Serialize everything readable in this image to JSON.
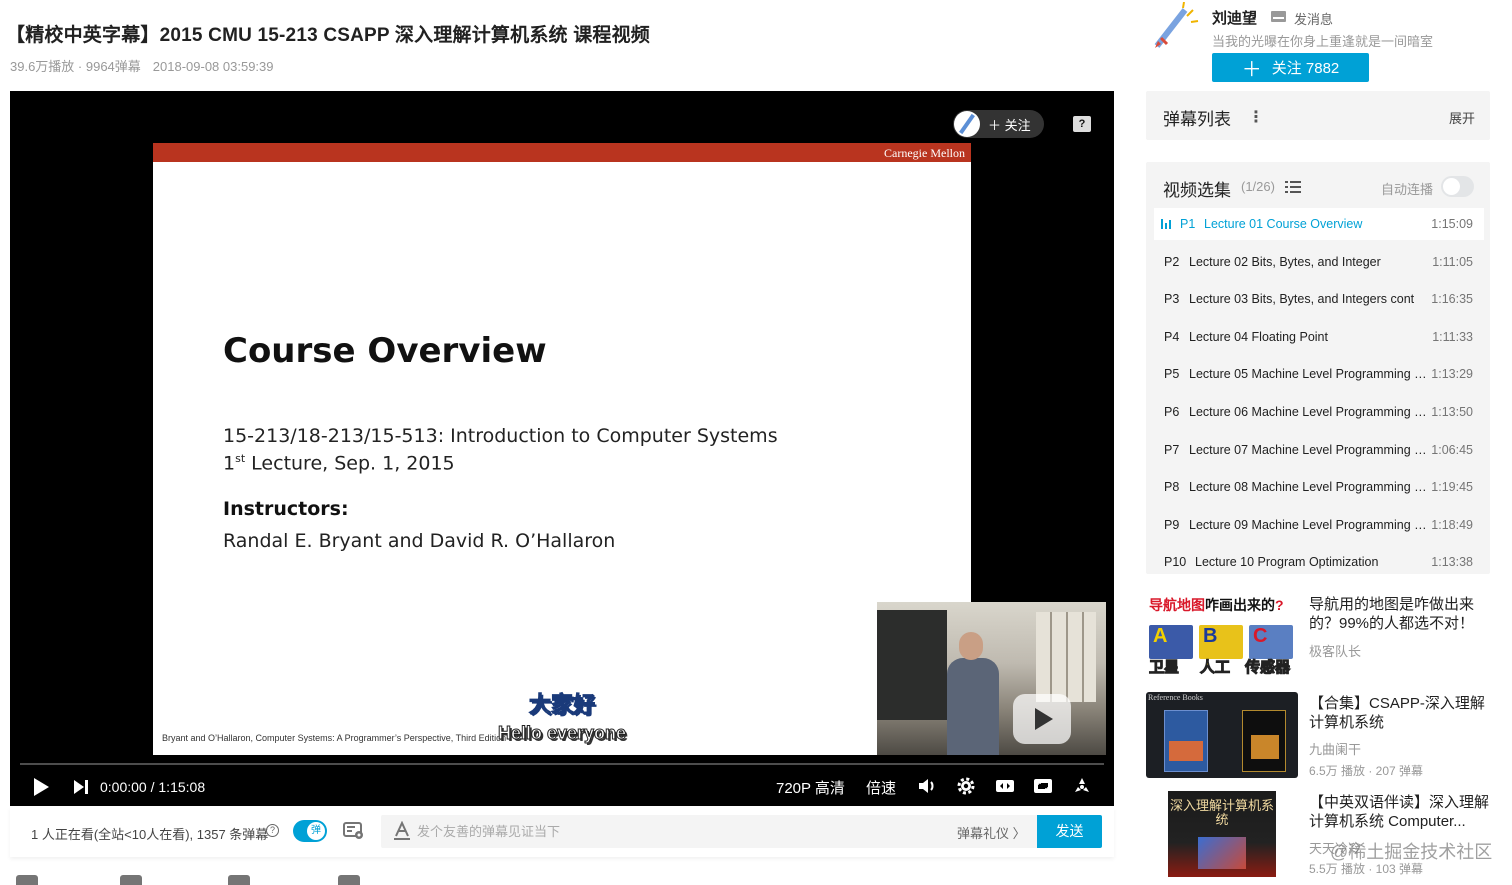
{
  "video": {
    "title": "【精校中英字幕】2015 CMU 15-213 CSAPP 深入理解计算机系统 课程视频",
    "stats": "39.6万播放 · 9964弹幕",
    "date": "2018-09-08 03:59:39"
  },
  "player": {
    "slide": {
      "brand": "Carnegie Mellon",
      "heading": "Course Overview",
      "line1": "15-213/18-213/15-513: Introduction to Computer Systems",
      "line2_num": "1",
      "line2_sup": "st",
      "line2_rest": " Lecture, Sep. 1, 2015",
      "instructors_label": "Instructors:",
      "instructors": "Randal E. Bryant and David R. O’Hallaron",
      "footer": "Bryant and O’Hallaron, Computer Systems: A Programmer’s Perspective, Third Edition"
    },
    "subtitle_cn": "大家好",
    "subtitle_en": "Hello everyone",
    "follow_chip": "＋ 关注",
    "report_icon": "?",
    "time_current": "0:00:00",
    "time_separator": "/",
    "time_total": "1:15:08",
    "quality": "720P 高清",
    "speed": "倍速",
    "progress": 0,
    "icons": [
      "play-icon",
      "next-icon",
      "volume-icon",
      "settings-icon",
      "widescreen-icon",
      "web-fullscreen-icon",
      "fullscreen-icon",
      "radiation-icon"
    ]
  },
  "danmaku_bar": {
    "viewers": "1 人正在看(全站<10人在看), 1357 条弹幕",
    "help": "?",
    "toggle_label": "弹",
    "toggle_on": true,
    "input_placeholder": "发个友善的弹幕见证当下",
    "etiquette": "弹幕礼仪 〉",
    "send": "发送"
  },
  "up": {
    "name": "刘迪望",
    "message": "发消息",
    "signature": "当我的光曝在你身上重逢就是一间暗室",
    "follow_plus": "＋",
    "follow_label": "关注 7882"
  },
  "danmaku_list": {
    "title": "弹幕列表",
    "more": "⋮",
    "expand": "展开"
  },
  "episodes": {
    "title": "视频选集",
    "count": "(1/26)",
    "autoplay": "自动连播",
    "autoplay_on": false,
    "items": [
      {
        "idx": "P1",
        "name": "Lecture 01 Course Overview",
        "dur": "1:15:09"
      },
      {
        "idx": "P2",
        "name": "Lecture 02 Bits, Bytes, and Integer",
        "dur": "1:11:05"
      },
      {
        "idx": "P3",
        "name": "Lecture 03 Bits, Bytes, and Integers cont",
        "dur": "1:16:35"
      },
      {
        "idx": "P4",
        "name": "Lecture 04 Floating Point",
        "dur": "1:11:33"
      },
      {
        "idx": "P5",
        "name": "Lecture 05 Machine Level Programming I B...",
        "dur": "1:13:29"
      },
      {
        "idx": "P6",
        "name": "Lecture 06 Machine Level Programming II C...",
        "dur": "1:13:50"
      },
      {
        "idx": "P7",
        "name": "Lecture 07 Machine Level Programming III ...",
        "dur": "1:06:45"
      },
      {
        "idx": "P8",
        "name": "Lecture 08 Machine Level Programming IV ...",
        "dur": "1:19:45"
      },
      {
        "idx": "P9",
        "name": "Lecture 09 Machine Level Programming V ...",
        "dur": "1:18:49"
      },
      {
        "idx": "P10",
        "name": "Lecture 10 Program Optimization",
        "dur": "1:13:38"
      }
    ]
  },
  "recommendations": [
    {
      "title": "导航用的地图是咋做出来的？99%的人都选不对！",
      "author": "极客队长",
      "stats": "",
      "thumb": {
        "headline_red": "导航地图",
        "headline_black": "咋画出来的",
        "headline_q": "?",
        "labels": [
          "卫星",
          "人工",
          "传感器"
        ],
        "letters": [
          "A",
          "B",
          "C"
        ]
      }
    },
    {
      "title": "【合集】CSAPP-深入理解计算机系统",
      "author": "九曲阑干",
      "stats": "6.5万 播放 · 207 弹幕",
      "thumb": {
        "label": "Reference Books"
      }
    },
    {
      "title": "【中英双语伴读】深入理解计算机系统 Computer...",
      "author": "天天冷冷",
      "stats": "5.5万 播放 · 103 弹幕",
      "thumb": {
        "text": "深入理解计算机系统"
      }
    }
  ],
  "watermark": "@稀土掘金技术社区",
  "colors": {
    "accent": "#00a1d6",
    "slide_bar": "#b9341f",
    "subtitle_cn": "#ffe23c"
  }
}
